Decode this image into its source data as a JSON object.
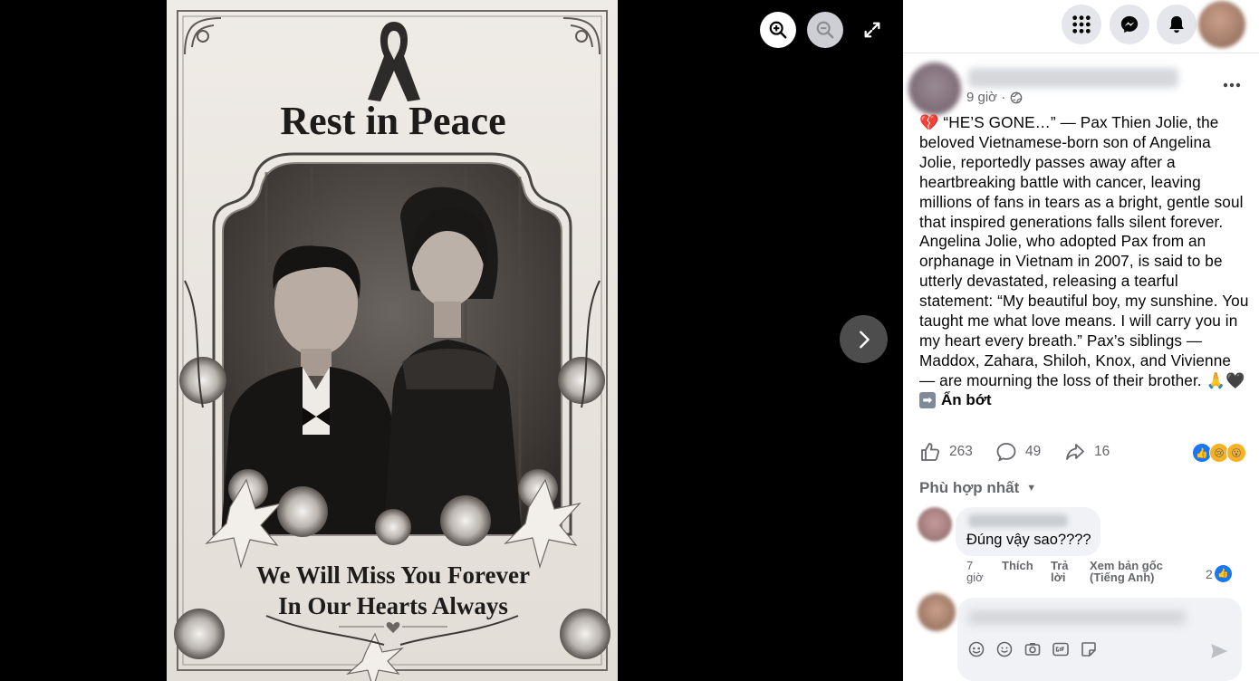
{
  "viewer": {
    "image": {
      "title_text": "Rest in Peace",
      "bottom_line1": "We Will Miss You Forever",
      "bottom_line2": "In Our Hearts Always"
    }
  },
  "topbar": {
    "menu_icon": "grid-icon",
    "messenger_icon": "messenger-icon",
    "notification_icon": "bell-icon"
  },
  "post": {
    "time": "9 giờ ·",
    "text": "💔 “HE’S GONE…” — Pax Thien Jolie, the beloved Vietnamese-born son of Angelina Jolie, reportedly passes away after a heartbreaking battle with cancer, leaving millions of fans in tears as a bright, gentle soul that inspired generations falls silent forever. Angelina Jolie, who adopted Pax from an orphanage in Vietnam in 2007, is said to be utterly devastated, releasing a tearful statement: “My beautiful boy, my sunshine. You taught me what love means. I will carry you in my heart every breath.” Pax’s siblings — Maddox, Zahara, Shiloh, Knox, and Vivienne — are mourning the loss of their brother. 🙏🖤",
    "see_less": "Ẩn bớt",
    "stats": {
      "likes": "263",
      "comments": "49",
      "shares": "16"
    }
  },
  "comments": {
    "sort_label": "Phù hợp nhất",
    "items": [
      {
        "text": "Đúng vậy sao????",
        "time": "7 giờ",
        "like_label": "Thích",
        "reply_label": "Trả lời",
        "see_original": "Xem bản gốc (Tiếng Anh)",
        "reaction_count": "2"
      }
    ]
  },
  "colors": {
    "accent": "#1877f2",
    "secondary_text": "#65676b",
    "bubble": "#f0f2f5"
  }
}
